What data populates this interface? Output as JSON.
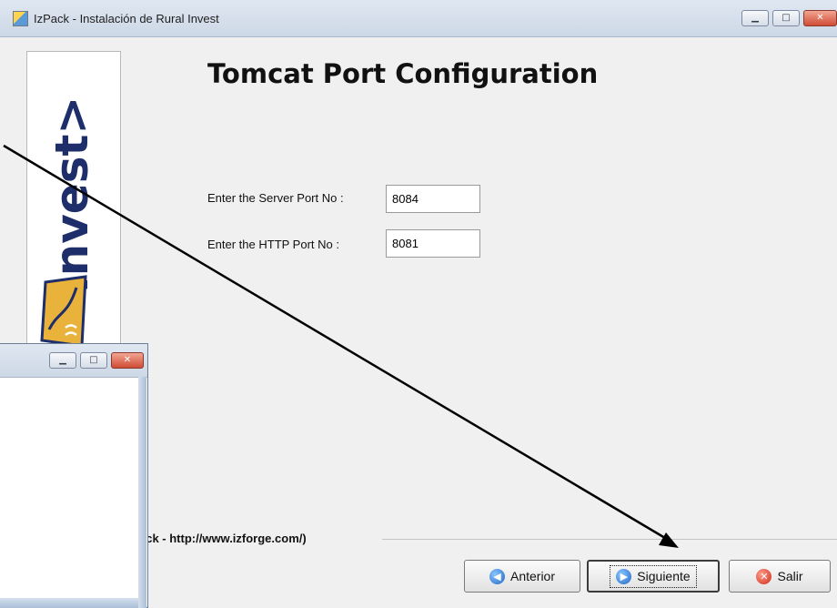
{
  "window": {
    "title": "IzPack - Instalación de Rural Invest",
    "controls": [
      "minimize",
      "maximize",
      "close"
    ]
  },
  "logo": {
    "text": "Invest>",
    "mark_icon": "rural-invest-logo-icon"
  },
  "page": {
    "heading": "Tomcat Port Configuration"
  },
  "form": {
    "server_port_label": "Enter the Server Port No :",
    "server_port_value": "8084",
    "http_port_label": "Enter the HTTP Port No :",
    "http_port_value": "8081"
  },
  "footer": {
    "text": "ack - http://www.izforge.com/)"
  },
  "buttons": {
    "back_label": "Anterior",
    "next_label": "Siguiente",
    "quit_label": "Salir"
  },
  "colors": {
    "titlebar": "#cdd8e6",
    "logo_text": "#1d2e6a",
    "annotation_arrow": "#000000"
  }
}
